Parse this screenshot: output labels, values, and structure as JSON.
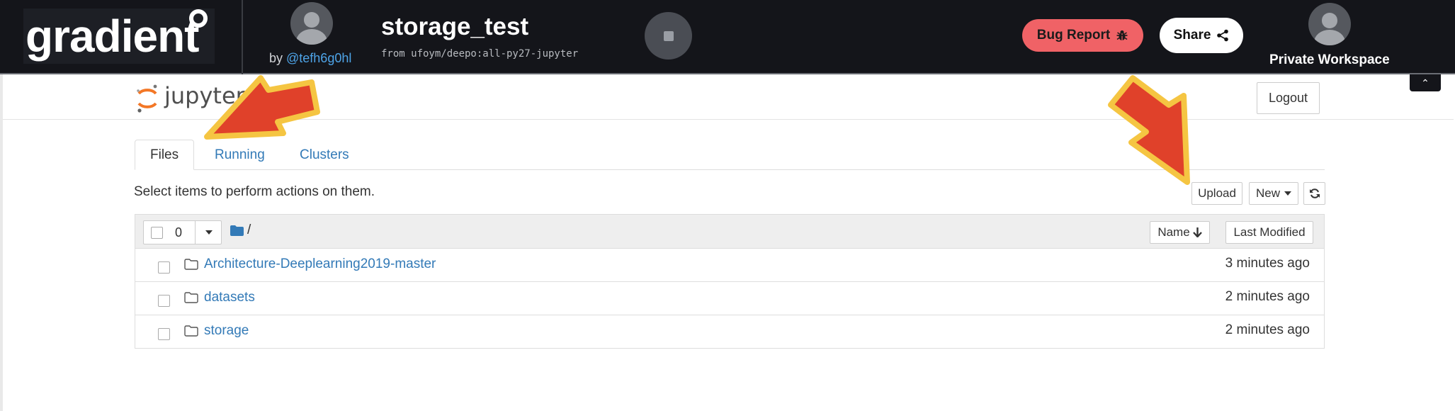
{
  "app": {
    "logo_text": "gradient",
    "notebook_title": "storage_test",
    "from_label": "from ufoym/deepo:all-py27-jupyter",
    "by_prefix": "by ",
    "owner_handle": "@tefh6g0hl",
    "bug_report_label": "Bug Report",
    "share_label": "Share",
    "workspace_label": "Private Workspace",
    "collapse_glyph": "⌃"
  },
  "jupyter": {
    "logo_text": "jupyter",
    "logout_label": "Logout",
    "tabs": [
      {
        "label": "Files",
        "active": true
      },
      {
        "label": "Running",
        "active": false
      },
      {
        "label": "Clusters",
        "active": false
      }
    ],
    "select_hint": "Select items to perform actions on them.",
    "upload_label": "Upload",
    "new_label": "New",
    "selected_count": "0",
    "breadcrumb": "/",
    "sort_name_label": "Name",
    "sort_modified_label": "Last Modified",
    "files": [
      {
        "name": "Architecture-Deeplearning2019-master",
        "modified": "3 minutes ago"
      },
      {
        "name": "datasets",
        "modified": "2 minutes ago"
      },
      {
        "name": "storage",
        "modified": "2 minutes ago"
      }
    ]
  },
  "colors": {
    "topbar_bg": "#14151a",
    "bug_report": "#f06266",
    "link": "#337ab7",
    "handle": "#4ea4e8",
    "annotation_arrow": "#e0412a",
    "annotation_outline": "#f5c542"
  },
  "icons": {
    "bug": "bug-icon",
    "share": "share-icon",
    "stop": "stop-icon",
    "refresh": "refresh-icon",
    "folder": "folder-icon",
    "sort_arrow": "arrow-down-icon",
    "caret": "caret-down-icon"
  }
}
